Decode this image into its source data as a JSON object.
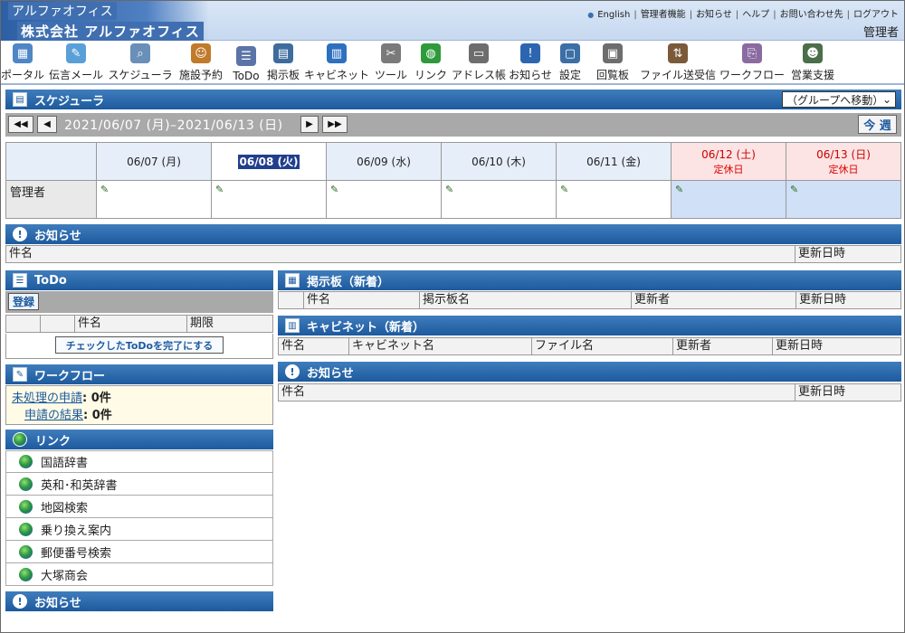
{
  "header": {
    "brand_small": "アルファオフィス",
    "company": "株式会社 アルファオフィス",
    "links": [
      "English",
      "管理者機能",
      "お知らせ",
      "ヘルプ",
      "お問い合わせ先",
      "ログアウト"
    ],
    "user": "管理者"
  },
  "toolbar": [
    {
      "label": "ポータル",
      "icon": "calendar-icon",
      "color": "#4f86c6"
    },
    {
      "label": "伝言メール",
      "icon": "memo-pen-icon",
      "color": "#5aa0d8"
    },
    {
      "label": "スケジューラ",
      "icon": "search-schedule-icon",
      "color": "#6a8fb8"
    },
    {
      "label": "施設予約",
      "icon": "people-icon",
      "color": "#c07a2a"
    },
    {
      "label": "ToDo",
      "icon": "checklist-icon",
      "color": "#5b74a8"
    },
    {
      "label": "掲示板",
      "icon": "board-icon",
      "color": "#3e6c9c"
    },
    {
      "label": "キャビネット",
      "icon": "cabinet-icon",
      "color": "#2d70c0"
    },
    {
      "label": "ツール",
      "icon": "tools-icon",
      "color": "#7a7a7a"
    },
    {
      "label": "リンク",
      "icon": "globe-icon",
      "color": "#2e9a3c"
    },
    {
      "label": "アドレス帳",
      "icon": "address-card-icon",
      "color": "#6d6d6d"
    },
    {
      "label": "お知らせ",
      "icon": "info-icon",
      "color": "#2d66b0"
    },
    {
      "label": "設定",
      "icon": "monitor-icon",
      "color": "#3b6fa6"
    },
    {
      "label": "回覧板",
      "icon": "clipboard-icon",
      "color": "#6d6d6d"
    },
    {
      "label": "ファイル送受信",
      "icon": "file-transfer-icon",
      "color": "#7b5a3a"
    },
    {
      "label": "ワークフロー",
      "icon": "workflow-icon",
      "color": "#8a6aa0"
    },
    {
      "label": "営業支援",
      "icon": "sales-icon",
      "color": "#4a6f4a"
    }
  ],
  "scheduler": {
    "title": "スケジューラ",
    "group_select": "（グループへ移動）",
    "range": "2021/06/07 (月)–2021/06/13 (日)",
    "week_btn": "今 週",
    "nav": {
      "prev_week": "◀◀",
      "prev_day": "◀",
      "next_day": "▶",
      "next_week": "▶▶"
    },
    "days": [
      {
        "date": "06/07 (月)",
        "note": "",
        "type": "weekday"
      },
      {
        "date": "06/08 (火)",
        "note": "",
        "type": "today"
      },
      {
        "date": "06/09 (水)",
        "note": "",
        "type": "weekday"
      },
      {
        "date": "06/10 (木)",
        "note": "",
        "type": "weekday"
      },
      {
        "date": "06/11 (金)",
        "note": "",
        "type": "weekday"
      },
      {
        "date": "06/12 (土)",
        "note": "定休日",
        "type": "sat"
      },
      {
        "date": "06/13 (日)",
        "note": "定休日",
        "type": "sun"
      }
    ],
    "member": "管理者"
  },
  "notice_top": {
    "title": "お知らせ",
    "cols": [
      "件名",
      "更新日時"
    ]
  },
  "todo": {
    "title": "ToDo",
    "register": "登録",
    "cols": [
      "",
      "",
      "件名",
      "期限"
    ],
    "complete_btn": "チェックしたToDoを完了にする"
  },
  "board": {
    "title": "掲示板（新着）",
    "cols": [
      "",
      "件名",
      "掲示板名",
      "更新者",
      "更新日時"
    ]
  },
  "cabinet": {
    "title": "キャビネット（新着）",
    "cols": [
      "件名",
      "キャビネット名",
      "ファイル名",
      "更新者",
      "更新日時"
    ]
  },
  "notice_right": {
    "title": "お知らせ",
    "cols": [
      "件名",
      "更新日時"
    ]
  },
  "workflow": {
    "title": "ワークフロー",
    "pending_label": "未処理の申請",
    "pending_count": ": 0件",
    "result_label": "申請の結果",
    "result_count": ": 0件"
  },
  "links": {
    "title": "リンク",
    "items": [
      "国語辞書",
      "英和･和英辞書",
      "地図検索",
      "乗り換え案内",
      "郵便番号検索",
      "大塚商会"
    ]
  },
  "notice_bottom": {
    "title": "お知らせ"
  }
}
